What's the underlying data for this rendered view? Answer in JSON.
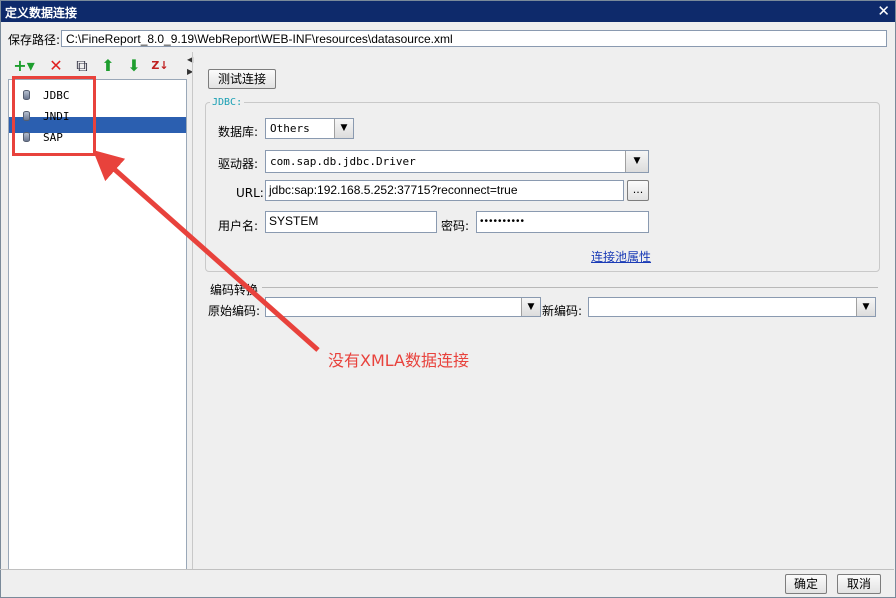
{
  "window": {
    "title": "定义数据连接",
    "close_glyph": "✕"
  },
  "path": {
    "label": "保存路径:",
    "value": "C:\\FineReport_8.0_9.19\\WebReport\\WEB-INF\\resources\\datasource.xml"
  },
  "toolbar": {
    "add_glyph": "+▾",
    "delete_glyph": "✕",
    "copy_glyph": "⧉",
    "up_glyph": "⬆",
    "down_glyph": "⬇",
    "sort_glyph": "Z↓"
  },
  "tree": {
    "items": [
      {
        "label": "JDBC"
      },
      {
        "label": "JNDI"
      },
      {
        "label": "SAP"
      }
    ],
    "selected_index": 2
  },
  "form": {
    "test_button": "测试连接",
    "group_label": "JDBC:",
    "database_label": "数据库:",
    "database_value": "Others",
    "driver_label": "驱动器:",
    "driver_value": "com.sap.db.jdbc.Driver",
    "url_label": "URL:",
    "url_value": "jdbc:sap:192.168.5.252:37715?reconnect=true",
    "url_browse": "...",
    "user_label": "用户名:",
    "user_value": "SYSTEM",
    "password_label": "密码:",
    "password_value": "••••••••••",
    "pool_link": "连接池属性"
  },
  "encoding": {
    "section_label": "编码转换",
    "original_label": "原始编码:",
    "original_value": "",
    "new_label": "新编码:",
    "new_value": ""
  },
  "footer": {
    "ok": "确定",
    "cancel": "取消"
  },
  "annotation": {
    "text": "没有XMLA数据连接",
    "color": "#e8423c"
  },
  "colors": {
    "titlebar": "#0e2a6b",
    "selection": "#2b5fb0",
    "link": "#1a3bb6",
    "group_label": "#1aa0b4"
  }
}
